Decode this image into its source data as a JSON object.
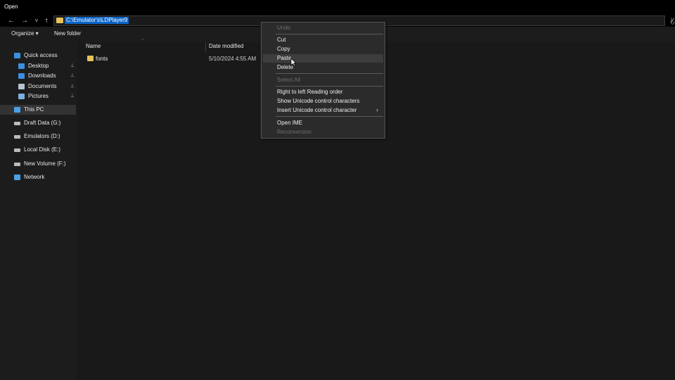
{
  "window": {
    "title": "Open"
  },
  "nav": {
    "back_glyph": "←",
    "forward_glyph": "→",
    "recent_glyph": "˅",
    "up_glyph": "↑",
    "address_path": "C:\\Emulator's\\LDPlayer9",
    "address_dropdown_glyph": "˅"
  },
  "toolbar": {
    "organize": "Organize ▾",
    "new_folder": "New folder"
  },
  "sidebar": {
    "items": [
      {
        "label": "Quick access",
        "icon": "star-icon",
        "color": "#3b8fe0"
      },
      {
        "label": "Desktop",
        "icon": "desktop-icon",
        "color": "#3b8fe0",
        "pinned": true
      },
      {
        "label": "Downloads",
        "icon": "download-icon",
        "color": "#3b8fe0",
        "pinned": true
      },
      {
        "label": "Documents",
        "icon": "documents-icon",
        "color": "#b8c4d0",
        "pinned": true
      },
      {
        "label": "Pictures",
        "icon": "pictures-icon",
        "color": "#7ab0e0",
        "pinned": true
      },
      {
        "label": "This PC",
        "icon": "computer-icon",
        "color": "#4aa0e6"
      },
      {
        "label": "Draft Data (G:)",
        "icon": "drive-icon",
        "color": "#bbbbbb"
      },
      {
        "label": "Emulators (D:)",
        "icon": "drive-icon",
        "color": "#bbbbbb"
      },
      {
        "label": "Local Disk (E:)",
        "icon": "drive-icon",
        "color": "#bbbbbb"
      },
      {
        "label": "New Volume (F:)",
        "icon": "drive-icon",
        "color": "#bbbbbb"
      },
      {
        "label": "Network",
        "icon": "network-icon",
        "color": "#4aa0e6"
      }
    ],
    "pin_glyph": "📌"
  },
  "columns": {
    "name": "Name",
    "date_modified": "Date modified"
  },
  "files": [
    {
      "name": "fonts",
      "date_modified": "5/10/2024 4:55 AM",
      "icon": "folder-icon"
    }
  ],
  "context_menu": {
    "items": [
      {
        "label": "Undo",
        "disabled": true
      },
      {
        "label": "Cut"
      },
      {
        "label": "Copy"
      },
      {
        "label": "Paste",
        "highlighted": true
      },
      {
        "label": "Delete"
      },
      {
        "label": "Select All",
        "disabled": true
      },
      {
        "label": "Right to left Reading order"
      },
      {
        "label": "Show Unicode control characters"
      },
      {
        "label": "Insert Unicode control character",
        "submenu": true
      },
      {
        "label": "Open IME"
      },
      {
        "label": "Reconversion",
        "disabled": true
      }
    ],
    "submenu_glyph": "›"
  },
  "colors": {
    "accent": "#0a64c8",
    "folder": "#e8c15a"
  }
}
